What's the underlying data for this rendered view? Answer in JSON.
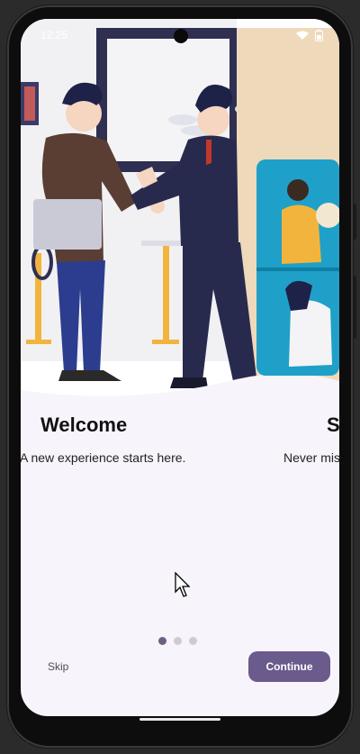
{
  "status_bar": {
    "time": "12:25"
  },
  "slides": [
    {
      "title": "Welcome",
      "subtitle": "A new experience starts here."
    },
    {
      "title": "St",
      "subtitle": "Never miss"
    }
  ],
  "pager": {
    "total": 3,
    "current": 1
  },
  "actions": {
    "skip_label": "Skip",
    "continue_label": "Continue"
  },
  "colors": {
    "accent": "#6b5a8c",
    "background": "#f8f4fb"
  }
}
